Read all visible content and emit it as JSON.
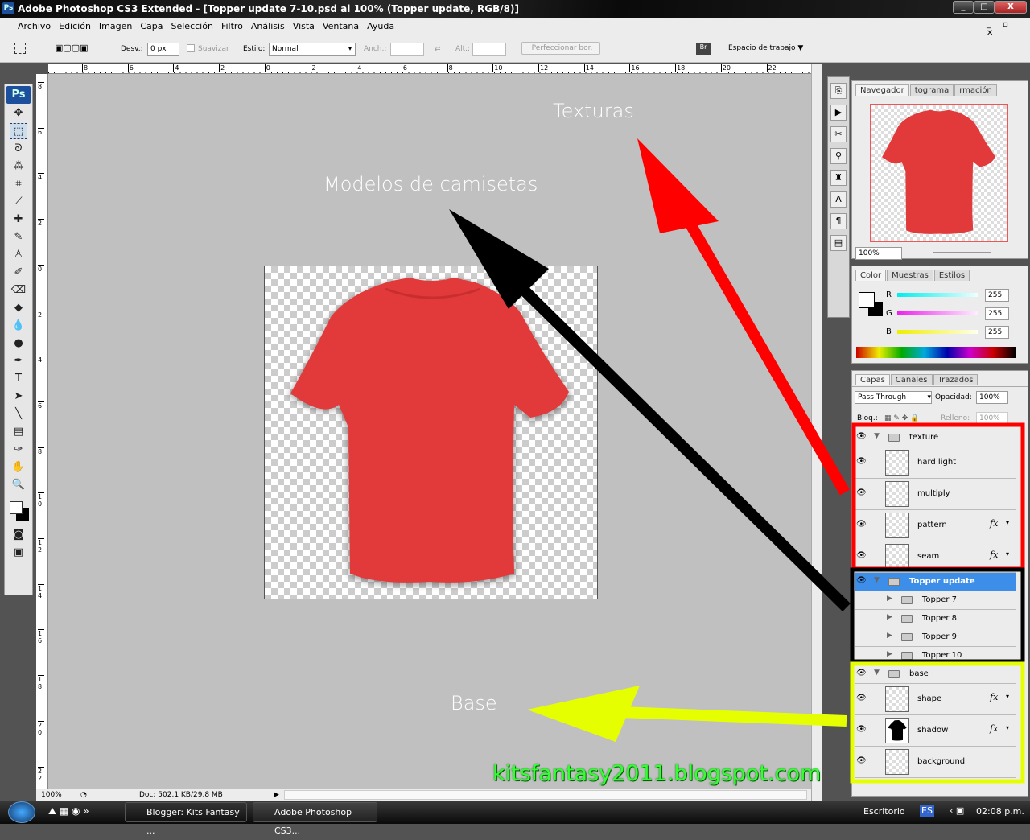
{
  "window": {
    "title": "Adobe Photoshop CS3 Extended - [Topper update 7-10.psd al 100% (Topper update, RGB/8)]",
    "app_icon": "Ps"
  },
  "menu": [
    "Archivo",
    "Edición",
    "Imagen",
    "Capa",
    "Selección",
    "Filtro",
    "Análisis",
    "Vista",
    "Ventana",
    "Ayuda"
  ],
  "options": {
    "desv_label": "Desv.:",
    "desv_value": "0 px",
    "suavizar": "Suavizar",
    "estilo_label": "Estilo:",
    "estilo_value": "Normal",
    "anch_label": "Anch.:",
    "alt_label": "Alt.:",
    "refine": "Perfeccionar bor.",
    "workspace": "Espacio de trabajo",
    "bridge": "Br"
  },
  "ruler_top": [
    "8",
    "6",
    "4",
    "2",
    "0",
    "2",
    "4",
    "6",
    "8",
    "10",
    "12",
    "14",
    "16",
    "18",
    "20",
    "22"
  ],
  "ruler_left": [
    "8",
    "6",
    "4",
    "2",
    "0",
    "2",
    "4",
    "6",
    "8",
    "1 0",
    "1 2",
    "1 4",
    "1 6",
    "1 8",
    "2 0",
    "2 2"
  ],
  "status": {
    "zoom": "100%",
    "doc": "Doc: 502.1 KB/29.8 MB"
  },
  "annotations": {
    "texturas": "Texturas",
    "modelos": "Modelos de camisetas",
    "base": "Base",
    "watermark": "kitsfantasy2011.blogspot.com",
    "colors": {
      "texturas": "#ff0000",
      "modelos": "#000000",
      "base": "#e6ff00",
      "watermark": "#33ff33"
    }
  },
  "navigator": {
    "tabs": [
      "Navegador",
      "tograma",
      "rmación"
    ],
    "zoom": "100%"
  },
  "color": {
    "tabs": [
      "Color",
      "Muestras",
      "Estilos"
    ],
    "r_label": "R",
    "g_label": "G",
    "b_label": "B",
    "r": "255",
    "g": "255",
    "b": "255"
  },
  "layers": {
    "tabs": [
      "Capas",
      "Canales",
      "Trazados"
    ],
    "blend": "Pass Through",
    "opacity_label": "Opacidad:",
    "opacity": "100%",
    "lock_label": "Bloq.:",
    "fill_label": "Relleno:",
    "fill": "100%",
    "items": [
      {
        "name": "texture",
        "type": "group",
        "open": true
      },
      {
        "name": "hard light",
        "type": "layer"
      },
      {
        "name": "multiply",
        "type": "layer"
      },
      {
        "name": "pattern",
        "type": "layer",
        "fx": "fx"
      },
      {
        "name": "seam",
        "type": "layer",
        "fx": "fx"
      },
      {
        "name": "Topper update",
        "type": "group",
        "open": true,
        "selected": true
      },
      {
        "name": "Topper 7",
        "type": "subgroup"
      },
      {
        "name": "Topper 8",
        "type": "subgroup"
      },
      {
        "name": "Topper 9",
        "type": "subgroup"
      },
      {
        "name": "Topper 10",
        "type": "subgroup"
      },
      {
        "name": "base",
        "type": "group",
        "open": true
      },
      {
        "name": "shape",
        "type": "layer",
        "fx": "fx"
      },
      {
        "name": "shadow",
        "type": "layer",
        "fx": "fx"
      },
      {
        "name": "background",
        "type": "layer"
      }
    ]
  },
  "taskbar": {
    "tasks": [
      "Blogger: Kits Fantasy ...",
      "Adobe Photoshop CS3..."
    ],
    "escritorio": "Escritorio",
    "lang": "ES",
    "time": "02:08 p.m."
  }
}
